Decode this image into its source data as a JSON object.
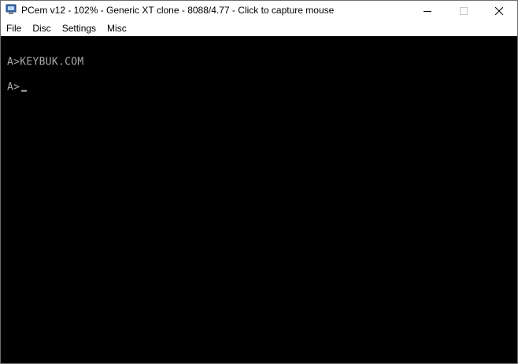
{
  "window": {
    "title": "PCem v12 - 102% - Generic XT clone - 8088/4.77 - Click to capture mouse"
  },
  "controls": {
    "minimize_icon": "minimize-icon",
    "maximize_icon": "maximize-icon",
    "close_icon": "close-icon"
  },
  "menu": {
    "items": [
      {
        "label": "File"
      },
      {
        "label": "Disc"
      },
      {
        "label": "Settings"
      },
      {
        "label": "Misc"
      }
    ]
  },
  "screen": {
    "lines": [
      {
        "text": "A>KEYBUK.COM"
      },
      {
        "text": "A>"
      }
    ],
    "text_color": "#aaaaaa",
    "background": "#000000"
  }
}
